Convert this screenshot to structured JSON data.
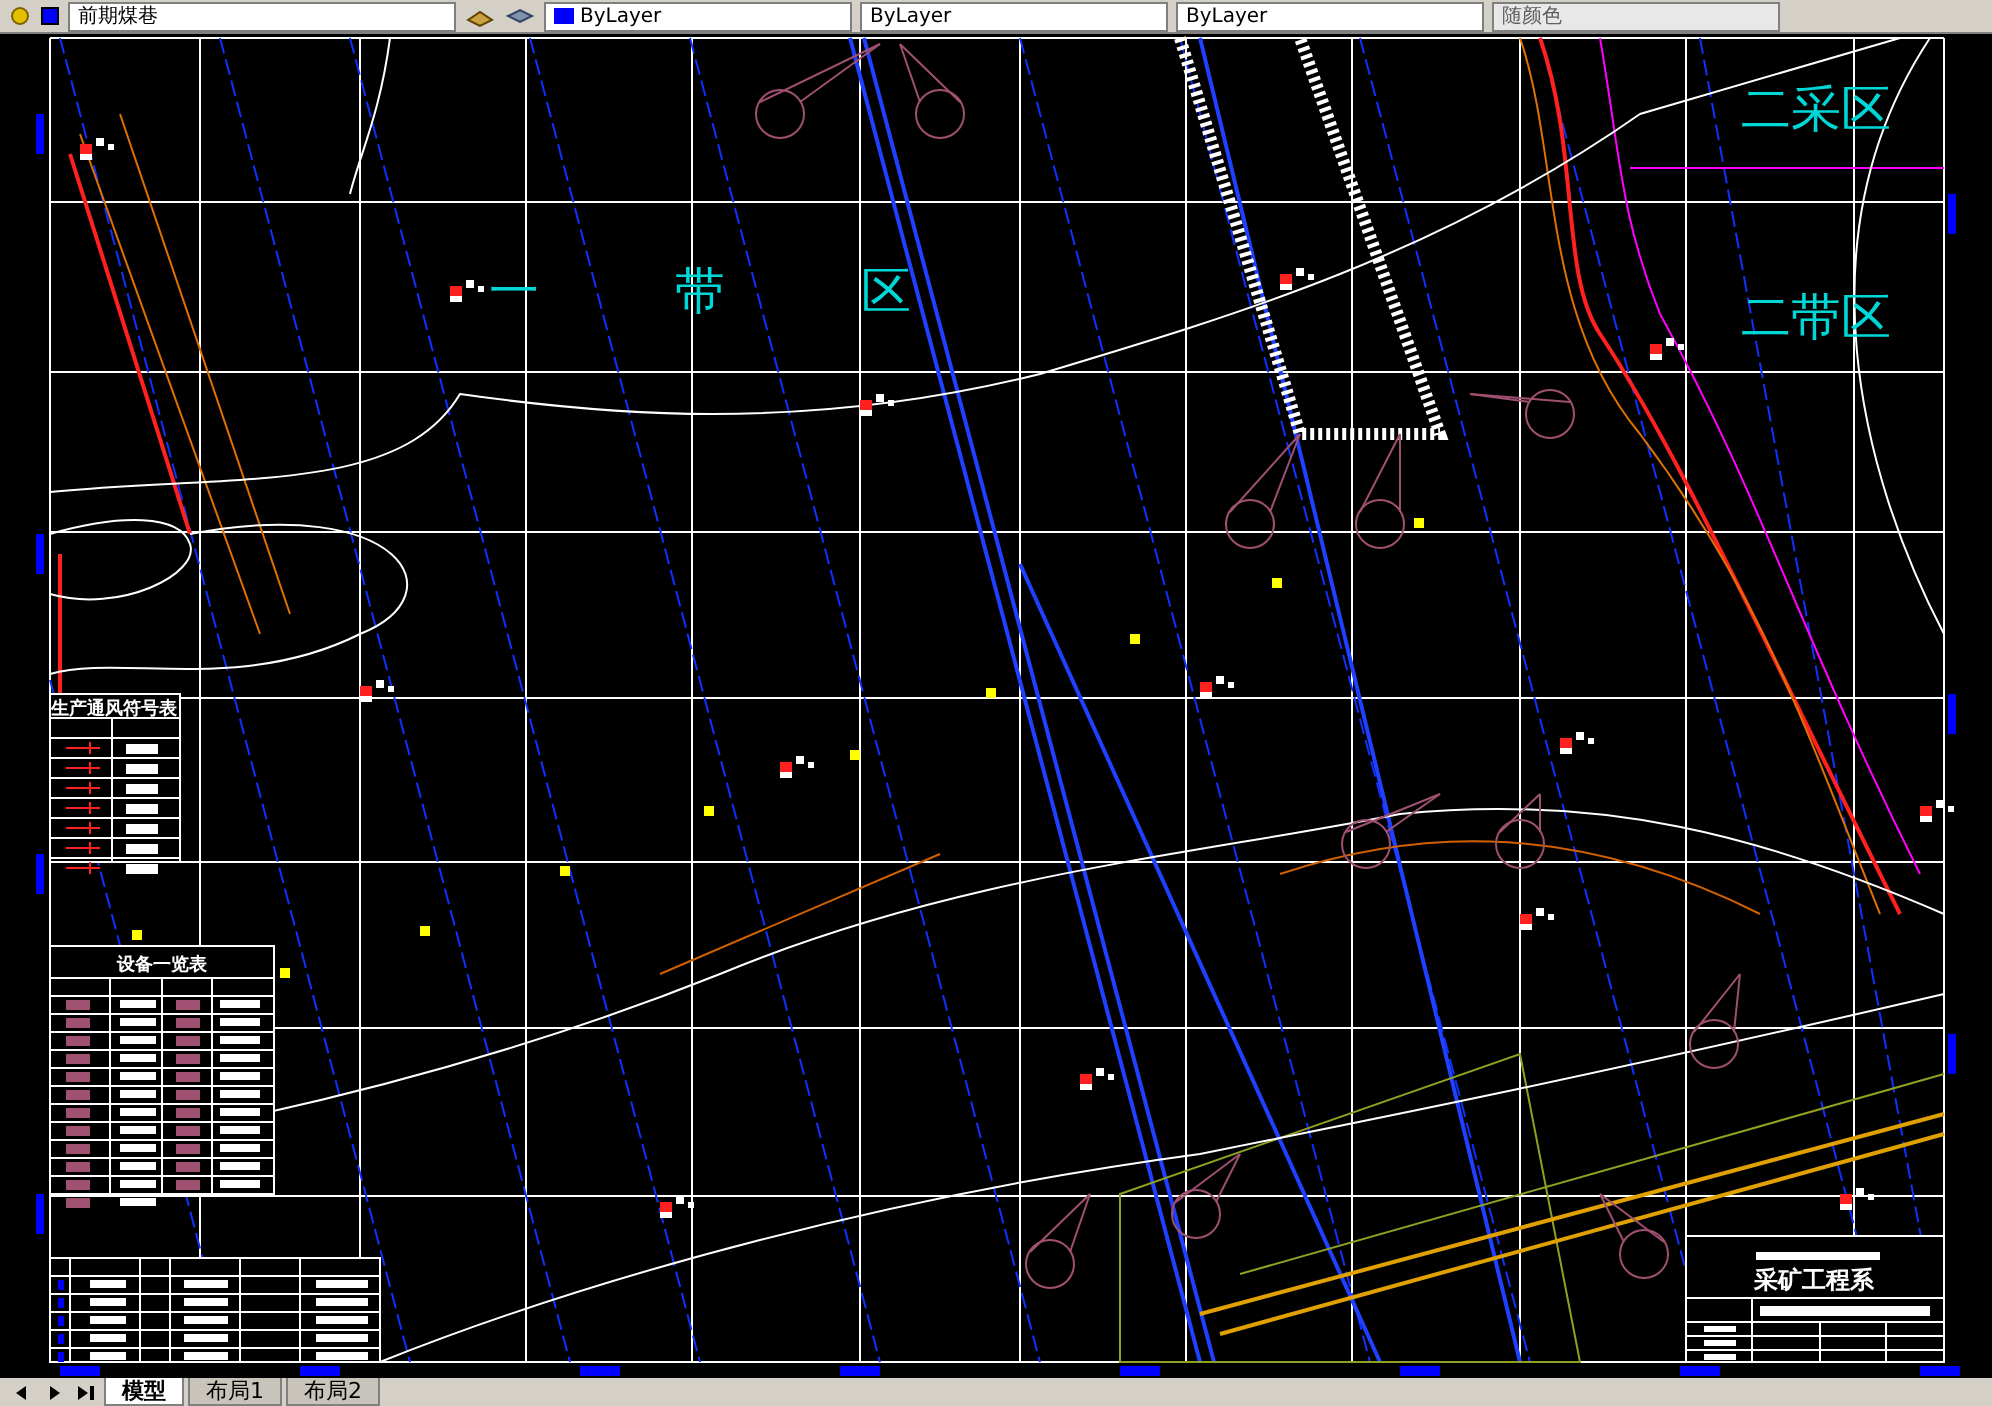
{
  "toolbar": {
    "layer": "前期煤巷",
    "color_value": "ByLayer",
    "linetype": "ByLayer",
    "lineweight": "ByLayer",
    "plot_style": "随颜色"
  },
  "drawing": {
    "zone_labels": [
      {
        "text": "一"
      },
      {
        "text": "带"
      },
      {
        "text": "区"
      },
      {
        "text": "二采区"
      },
      {
        "text": "二带区"
      }
    ],
    "ventilation_table": {
      "title": "生产通风符号表"
    },
    "equipment_table": {
      "title": "设备一览表"
    },
    "title_block": {
      "department": "采矿工程系"
    }
  },
  "tabs": [
    {
      "label": "模型",
      "selected": true
    },
    {
      "label": "布局1",
      "selected": false
    },
    {
      "label": "布局2",
      "selected": false
    }
  ]
}
